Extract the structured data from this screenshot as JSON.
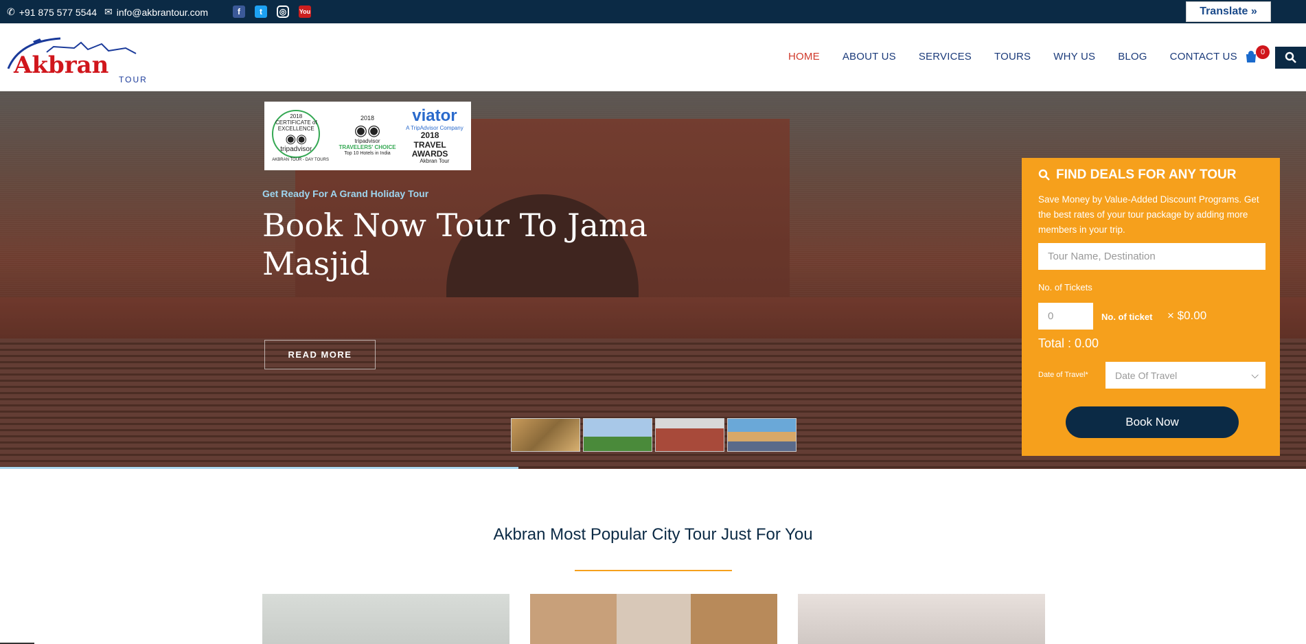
{
  "topbar": {
    "phone": "+91 875 577 5544",
    "email": "info@akbrantour.com",
    "socials": [
      {
        "name": "facebook-icon",
        "glyph": "f"
      },
      {
        "name": "twitter-icon",
        "glyph": "t"
      },
      {
        "name": "instagram-icon",
        "glyph": "◎"
      },
      {
        "name": "youtube-icon",
        "glyph": "You"
      }
    ],
    "translate_label": "Translate »"
  },
  "header": {
    "logo_text": "Akbran",
    "logo_sub": "TOUR",
    "nav": [
      {
        "label": "HOME",
        "active": true
      },
      {
        "label": "ABOUT US"
      },
      {
        "label": "SERVICES"
      },
      {
        "label": "TOURS"
      },
      {
        "label": "WHY US"
      },
      {
        "label": "BLOG"
      },
      {
        "label": "CONTACT US"
      }
    ],
    "cart_count": "0"
  },
  "hero": {
    "awards": {
      "a1": {
        "year": "2018",
        "title": "CERTIFICATE of EXCELLENCE",
        "brand": "tripadvisor",
        "caption": "AKBRAN TOUR - DAY TOURS"
      },
      "a2": {
        "year": "2018",
        "brand": "tripadvisor",
        "title": "TRAVELERS' CHOICE",
        "caption": "Top 10 Hotels in India"
      },
      "a3": {
        "brand": "viator",
        "sub": "A TripAdvisor Company",
        "title": "2018 TRAVEL AWARDS",
        "caption": "Akbran Tour"
      }
    },
    "subtitle": "Get Ready For A Grand Holiday Tour",
    "title": "Book Now Tour To Jama Masjid",
    "cta": "READ MORE"
  },
  "deals": {
    "title": "FIND DEALS FOR ANY TOUR",
    "description": "Save Money by Value-Added Discount Programs. Get the best rates of your tour package by adding more members in your trip.",
    "tour_placeholder": "Tour Name, Destination",
    "tickets_label": "No. of Tickets",
    "tickets_value": "0",
    "ticket_note": "No. of ticket",
    "price": "× $0.00",
    "total": "Total : 0.00",
    "date_label": "Date of Travel*",
    "date_placeholder": "Date Of Travel",
    "book_label": "Book Now",
    "accent": "#f6a01c"
  },
  "popular": {
    "title": "Akbran Most Popular City Tour Just For You"
  }
}
